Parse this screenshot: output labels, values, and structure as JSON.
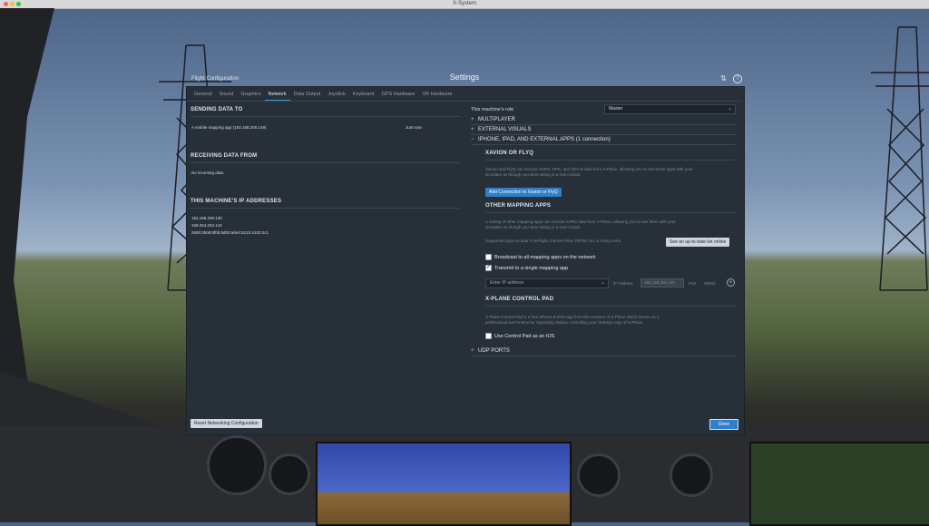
{
  "window": {
    "title": "X-System"
  },
  "header": {
    "flight_configuration": "Flight Configuration",
    "settings_title": "Settings",
    "icons": [
      "sliders-icon",
      "help-icon"
    ]
  },
  "tabs": [
    {
      "label": "General",
      "active": false
    },
    {
      "label": "Sound",
      "active": false
    },
    {
      "label": "Graphics",
      "active": false
    },
    {
      "label": "Network",
      "active": true
    },
    {
      "label": "Data Output",
      "active": false
    },
    {
      "label": "Joystick",
      "active": false
    },
    {
      "label": "Keyboard",
      "active": false
    },
    {
      "label": "GPS Hardware",
      "active": false
    },
    {
      "label": "VR Hardware",
      "active": false
    }
  ],
  "left": {
    "sending_title": "SENDING DATA TO",
    "sending_item": "A mobile mapping app (192.168.200.149)",
    "sending_time": "Just now",
    "receiving_title": "RECEIVING DATA FROM",
    "receiving_item": "No incoming data.",
    "ip_title": "THIS MACHINE'S IP ADDRESSES",
    "ips": [
      "192.168.200.130",
      "169.254.204.142",
      "2600:2b08:8f0b:5d00:a9e4:5213:4102:2c1"
    ],
    "reset_button": "Reset Networking Configuration"
  },
  "right": {
    "role_label": "This machine's role",
    "role_value": "Master",
    "multiplayer": "MULTIPLAYER",
    "external_visuals": "EXTERNAL VISUALS",
    "iphone_section": "IPHONE, IPAD, AND EXTERNAL APPS (1 connection)",
    "xavion_title": "XAVION OR FLYQ",
    "xavion_desc_1": "Xavion and FlyQ can receive AHRS, GPS, and ADS-B data from X-Plane, allowing you to use those apps with your",
    "xavion_desc_2": "simulator as though you were sitting in a real cockpit.",
    "add_connection": "Add Connection to Xavion or FlyQ",
    "other_title": "OTHER MAPPING APPS",
    "other_desc_1": "A variety of other mapping apps can receive AHRS data from X-Plane, allowing you to use them with your",
    "other_desc_2": "simulator as though you were sitting in a real cockpit.",
    "supported": "Supported apps include ForeFlight, Garmin Pilot, FltPlan Go, & many more.",
    "see_list": "See an up-to-date list online",
    "broadcast": "Broadcast to all mapping apps on the network",
    "broadcast_checked": false,
    "transmit": "Transmit to a single mapping app",
    "transmit_checked": true,
    "ip_select_placeholder": "Enter IP address",
    "ip_label": "IP Address",
    "ip_value": "192.168.200.149",
    "port_label": "Port",
    "port_value": "49002",
    "control_pad_title": "X-PLANE CONTROL PAD",
    "control_pad_desc_1": "X-Plane Control Pad is a free iPhone & iPad app from the creators of X-Plane which serves as a",
    "control_pad_desc_2": "professional level Instructor Operating Station controlling your desktop copy of X-Plane.",
    "use_control_pad": "Use Control Pad as an IOS",
    "use_control_pad_checked": false,
    "udp_ports": "UDP PORTS",
    "done_button": "Done"
  },
  "colors": {
    "accent": "#2f7fc9",
    "dialog_bg": "#273039"
  }
}
